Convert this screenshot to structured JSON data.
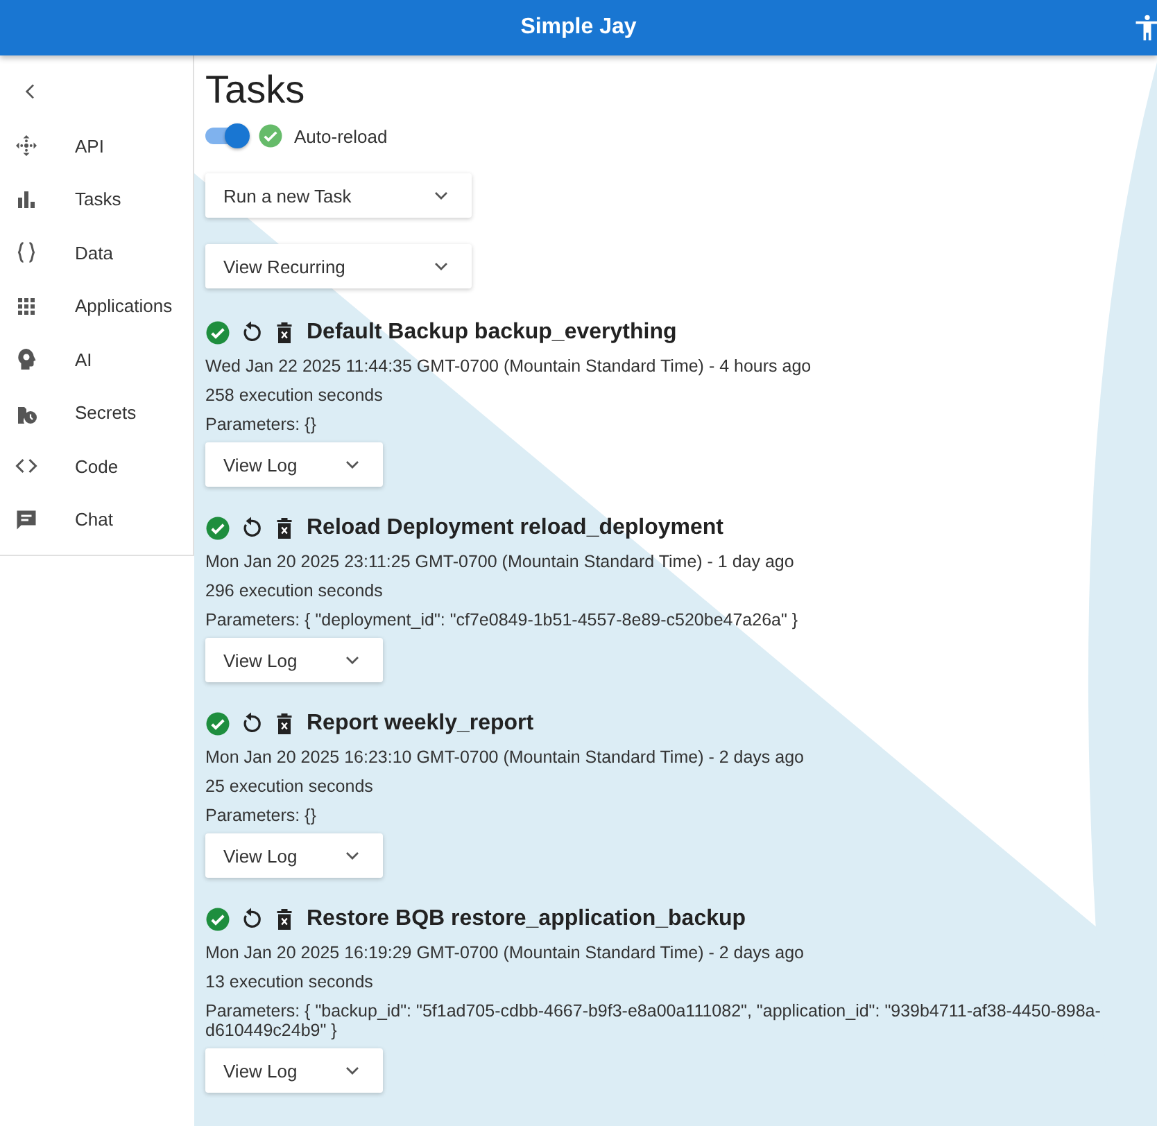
{
  "app_bar": {
    "title": "Simple Jay"
  },
  "sidebar": {
    "items": [
      {
        "label": "API"
      },
      {
        "label": "Tasks"
      },
      {
        "label": "Data"
      },
      {
        "label": "Applications"
      },
      {
        "label": "AI"
      },
      {
        "label": "Secrets"
      },
      {
        "label": "Code"
      },
      {
        "label": "Chat"
      }
    ]
  },
  "page": {
    "title": "Tasks",
    "auto_reload": {
      "label": "Auto-reload",
      "on": true
    },
    "dropdowns": [
      "Run a new Task",
      "View Recurring"
    ],
    "tasks": [
      {
        "title": "Default Backup backup_everything",
        "time": "Wed Jan 22 2025 11:44:35 GMT-0700 (Mountain Standard Time) - 4 hours ago",
        "duration": "258 execution seconds",
        "parameters": "Parameters: {}",
        "log_button": "View Log"
      },
      {
        "title": "Reload Deployment reload_deployment",
        "time": "Mon Jan 20 2025 23:11:25 GMT-0700 (Mountain Standard Time) - 1 day ago",
        "duration": "296 execution seconds",
        "parameters": "Parameters: { \"deployment_id\": \"cf7e0849-1b51-4557-8e89-c520be47a26a\" }",
        "log_button": "View Log"
      },
      {
        "title": "Report weekly_report",
        "time": "Mon Jan 20 2025 16:23:10 GMT-0700 (Mountain Standard Time) - 2 days ago",
        "duration": "25 execution seconds",
        "parameters": "Parameters: {}",
        "log_button": "View Log"
      },
      {
        "title": "Restore BQB restore_application_backup",
        "time": "Mon Jan 20 2025 16:19:29 GMT-0700 (Mountain Standard Time) - 2 days ago",
        "duration": "13 execution seconds",
        "parameters": "Parameters: { \"backup_id\": \"5f1ad705-cdbb-4667-b9f3-e8a00a111082\", \"application_id\": \"939b4711-af38-4450-898a-d610449c24b9\" }",
        "log_button": "View Log"
      }
    ]
  }
}
